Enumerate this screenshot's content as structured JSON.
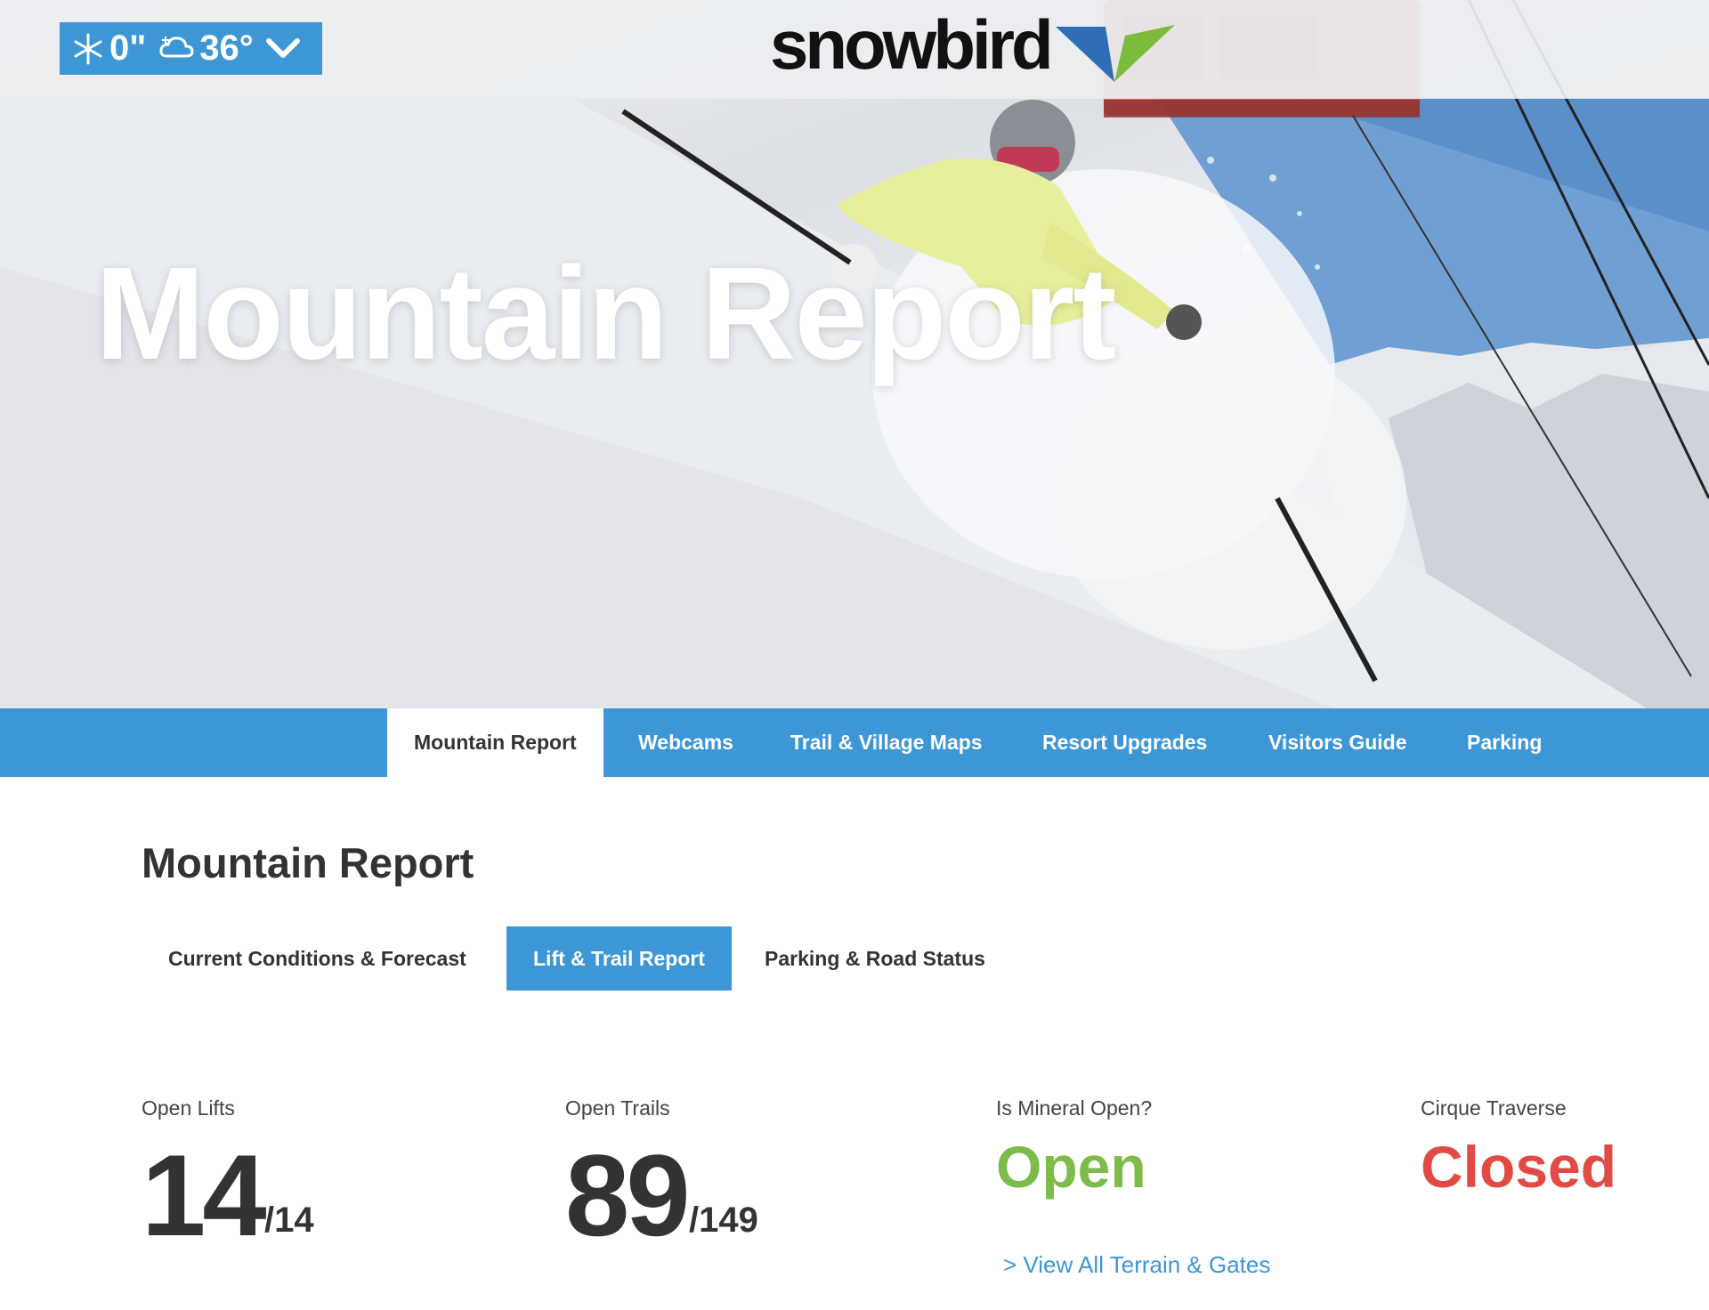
{
  "colors": {
    "accent": "#3d97d6",
    "open": "#7dbb4a",
    "closed": "#e24a45",
    "text": "#333333"
  },
  "weather": {
    "snowfall": "0\"",
    "temperature": "36°",
    "icons": [
      "snowflake-icon",
      "cloud-snow-icon",
      "chevron-down-icon"
    ]
  },
  "logo": {
    "text": "snowbird"
  },
  "hero": {
    "title": "Mountain Report"
  },
  "nav": {
    "tabs": [
      {
        "label": "Mountain Report",
        "active": true
      },
      {
        "label": "Webcams",
        "active": false
      },
      {
        "label": "Trail & Village Maps",
        "active": false
      },
      {
        "label": "Resort Upgrades",
        "active": false
      },
      {
        "label": "Visitors Guide",
        "active": false
      },
      {
        "label": "Parking",
        "active": false
      }
    ]
  },
  "content": {
    "title": "Mountain Report",
    "subtabs": [
      {
        "label": "Current Conditions & Forecast",
        "active": false
      },
      {
        "label": "Lift & Trail Report",
        "active": true
      },
      {
        "label": "Parking & Road Status",
        "active": false
      }
    ],
    "stats": {
      "open_lifts": {
        "label": "Open Lifts",
        "value": "14",
        "total": "/14"
      },
      "open_trails": {
        "label": "Open Trails",
        "value": "89",
        "total": "/149"
      },
      "mineral": {
        "label": "Is Mineral Open?",
        "status": "Open"
      },
      "cirque": {
        "label": "Cirque Traverse",
        "status": "Closed"
      }
    },
    "terrain_link": "> View All Terrain & Gates"
  }
}
